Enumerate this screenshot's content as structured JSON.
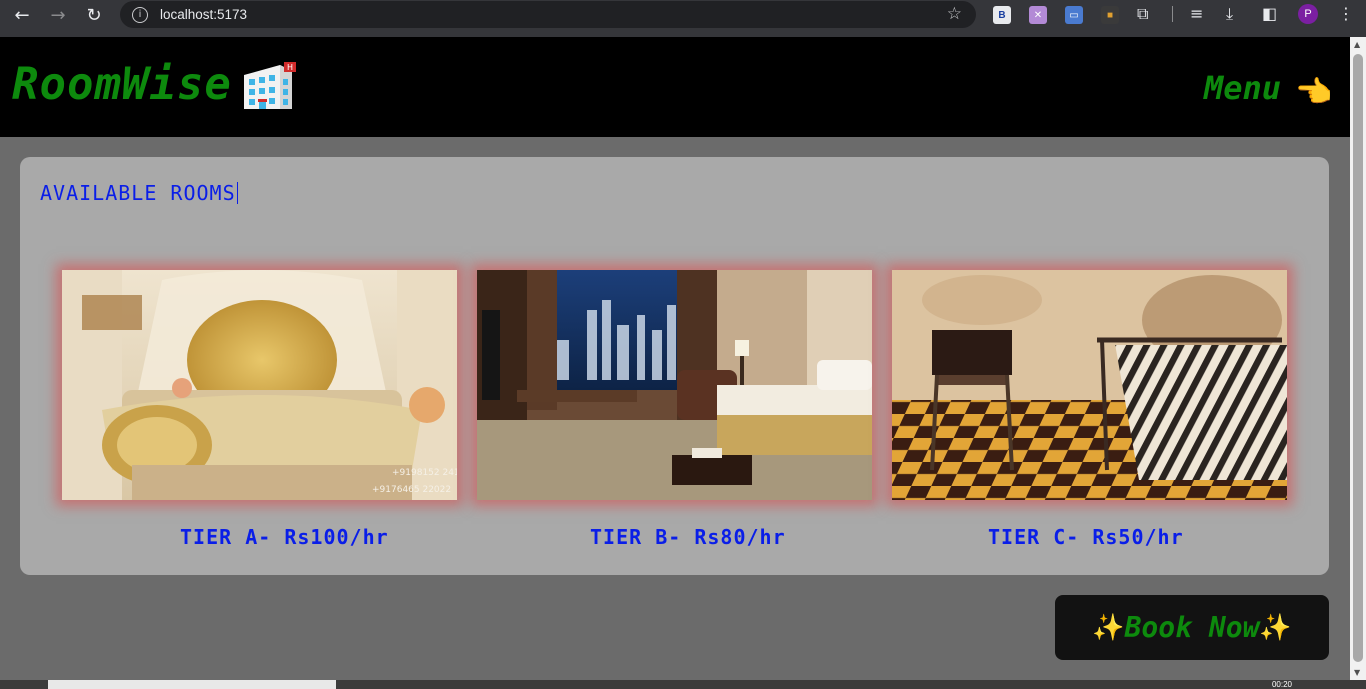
{
  "browser": {
    "url": "localhost:5173",
    "profile_initial": "P"
  },
  "header": {
    "logo_text": "RoomWise",
    "menu_label": "Menu",
    "menu_icon": "👈"
  },
  "panel": {
    "title": "AVAILABLE ROOMS",
    "rooms": [
      {
        "tier_label": "TIER A- Rs100/hr",
        "image": "luxury-golden-bedroom"
      },
      {
        "tier_label": "TIER B- Rs80/hr",
        "image": "modern-hotel-room-city-view"
      },
      {
        "tier_label": "TIER C- Rs50/hr",
        "image": "basic-room-checkered-floor"
      }
    ]
  },
  "book_button": {
    "label": "Book Now",
    "spark": "✨"
  },
  "taskbar": {
    "clock": "00:20"
  },
  "colors": {
    "brand_green": "#0d8a0d",
    "title_blue": "#0a1ee8",
    "panel_bg": "#a9a9a9",
    "page_bg": "#6b6b6b",
    "room_glow": "#dc4646"
  }
}
